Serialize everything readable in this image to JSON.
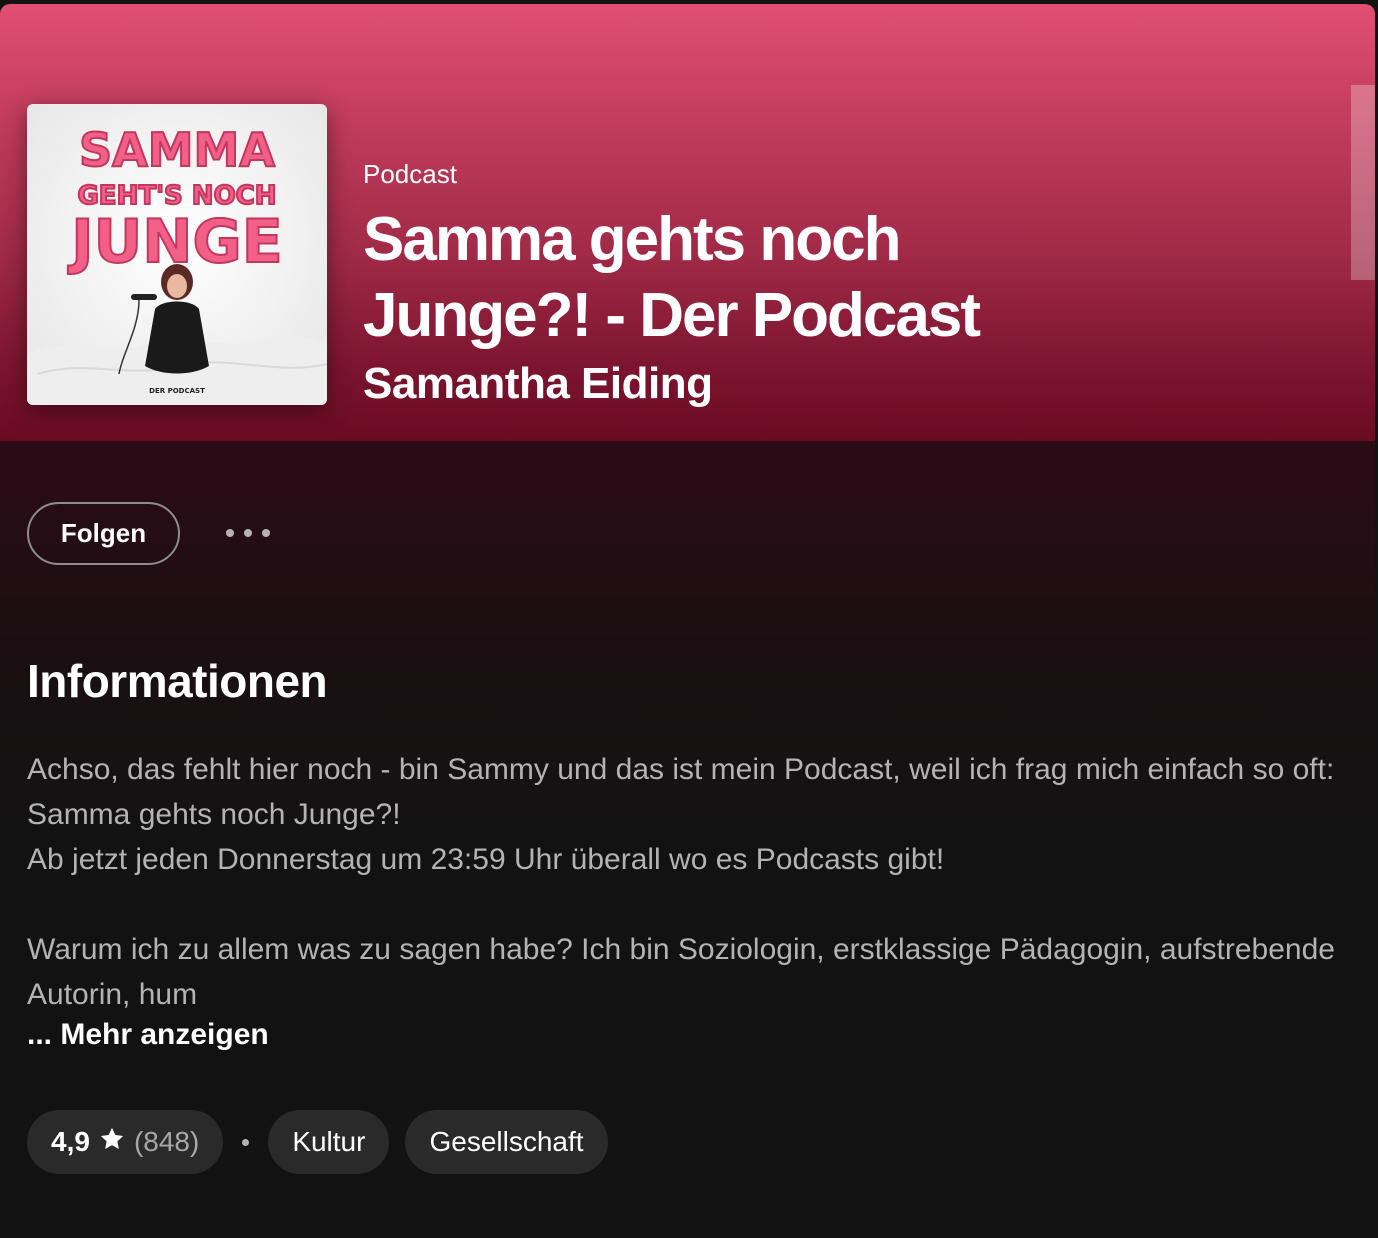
{
  "header": {
    "type_label": "Podcast",
    "title": "Samma gehts noch Junge?! - Der Podcast",
    "author": "Samantha Eiding"
  },
  "cover": {
    "line1": "SAMMA",
    "line2": "GEHT'S NOCH",
    "line3": "JUNGE",
    "footer": "DER PODCAST"
  },
  "actions": {
    "follow_label": "Folgen"
  },
  "info": {
    "heading": "Informationen",
    "paragraphs": [
      "Achso, das fehlt hier noch - bin Sammy und das ist mein Podcast, weil ich frag mich einfach so oft: Samma gehts noch Junge?!",
      "Ab jetzt jeden Donnerstag um 23:59 Uhr überall wo es Podcasts gibt!",
      "Warum ich zu allem was zu sagen habe? Ich bin Soziologin, erstklassige Pädagogin, aufstrebende Autorin, hum"
    ],
    "show_more": "... Mehr anzeigen"
  },
  "meta": {
    "rating": "4,9",
    "rating_count": "(848)",
    "tags": [
      "Kultur",
      "Gesellschaft"
    ]
  },
  "colors": {
    "hero_top": "#e14f71",
    "hero_bottom": "#6a0b22",
    "background": "#121212",
    "chip": "#2a2a2a"
  }
}
